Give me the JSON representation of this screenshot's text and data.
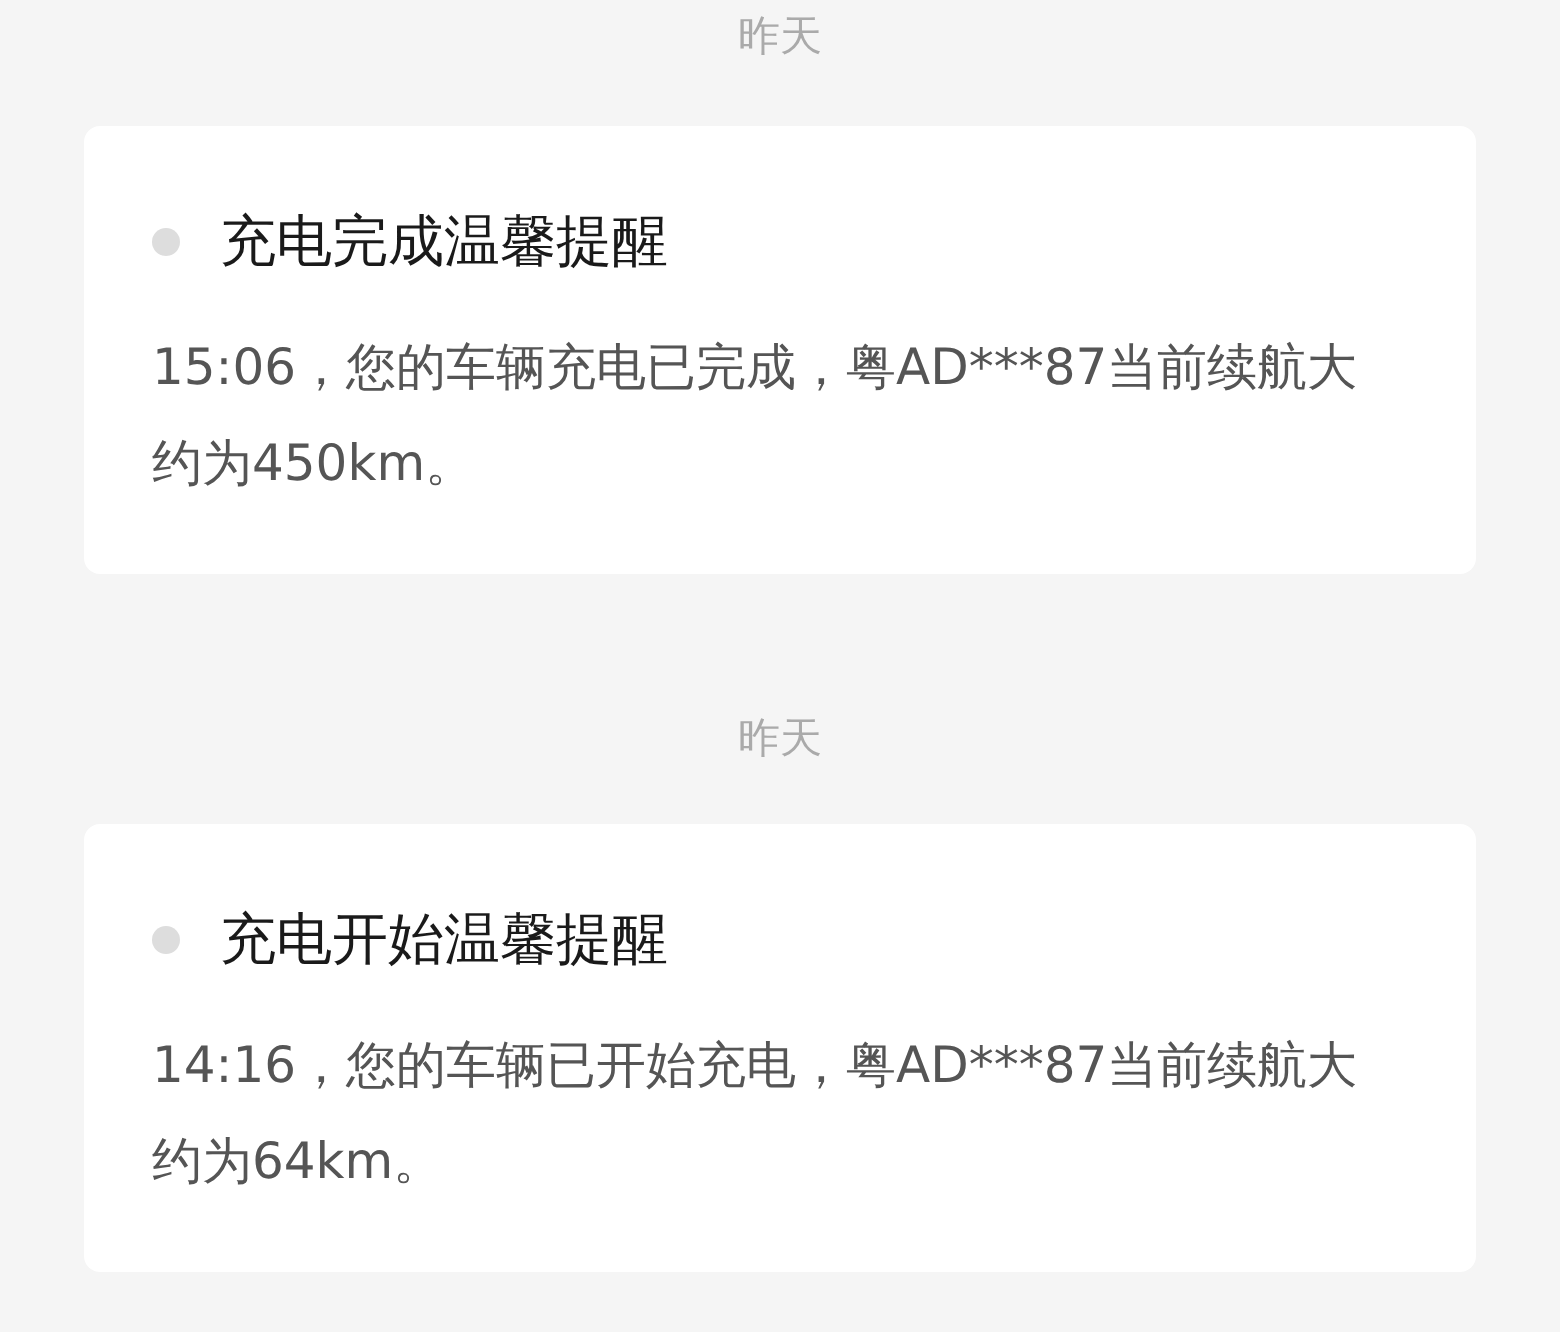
{
  "messages": [
    {
      "date": "昨天",
      "title": "充电完成温馨提醒",
      "body": "15:06，您的车辆充电已完成，粤AD***87当前续航大约为450km。"
    },
    {
      "date": "昨天",
      "title": "充电开始温馨提醒",
      "body": "14:16，您的车辆已开始充电，粤AD***87当前续航大约为64km。"
    }
  ]
}
